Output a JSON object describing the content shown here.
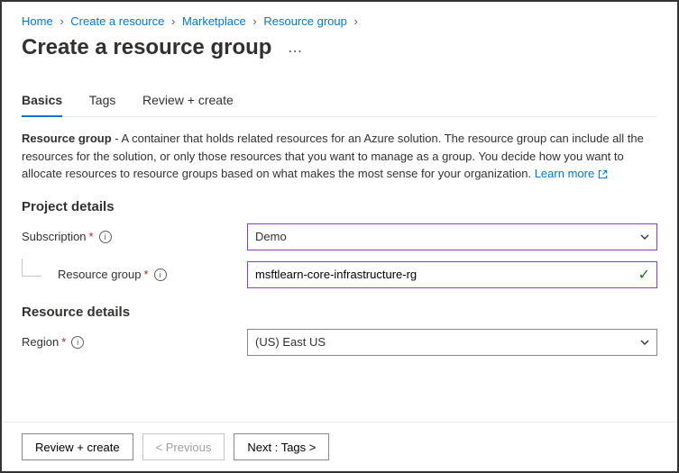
{
  "breadcrumb": {
    "items": [
      "Home",
      "Create a resource",
      "Marketplace",
      "Resource group"
    ]
  },
  "page": {
    "title": "Create a resource group"
  },
  "tabs": {
    "basics": "Basics",
    "tags": "Tags",
    "review": "Review + create"
  },
  "description": {
    "bold": "Resource group",
    "text": " - A container that holds related resources for an Azure solution. The resource group can include all the resources for the solution, or only those resources that you want to manage as a group. You decide how you want to allocate resources to resource groups based on what makes the most sense for your organization. ",
    "learn_more": "Learn more"
  },
  "sections": {
    "project_details": "Project details",
    "resource_details": "Resource details"
  },
  "fields": {
    "subscription": {
      "label": "Subscription",
      "value": "Demo"
    },
    "resource_group": {
      "label": "Resource group",
      "value": "msftlearn-core-infrastructure-rg"
    },
    "region": {
      "label": "Region",
      "value": "(US) East US"
    }
  },
  "footer": {
    "review": "Review + create",
    "previous": "< Previous",
    "next": "Next : Tags >"
  }
}
